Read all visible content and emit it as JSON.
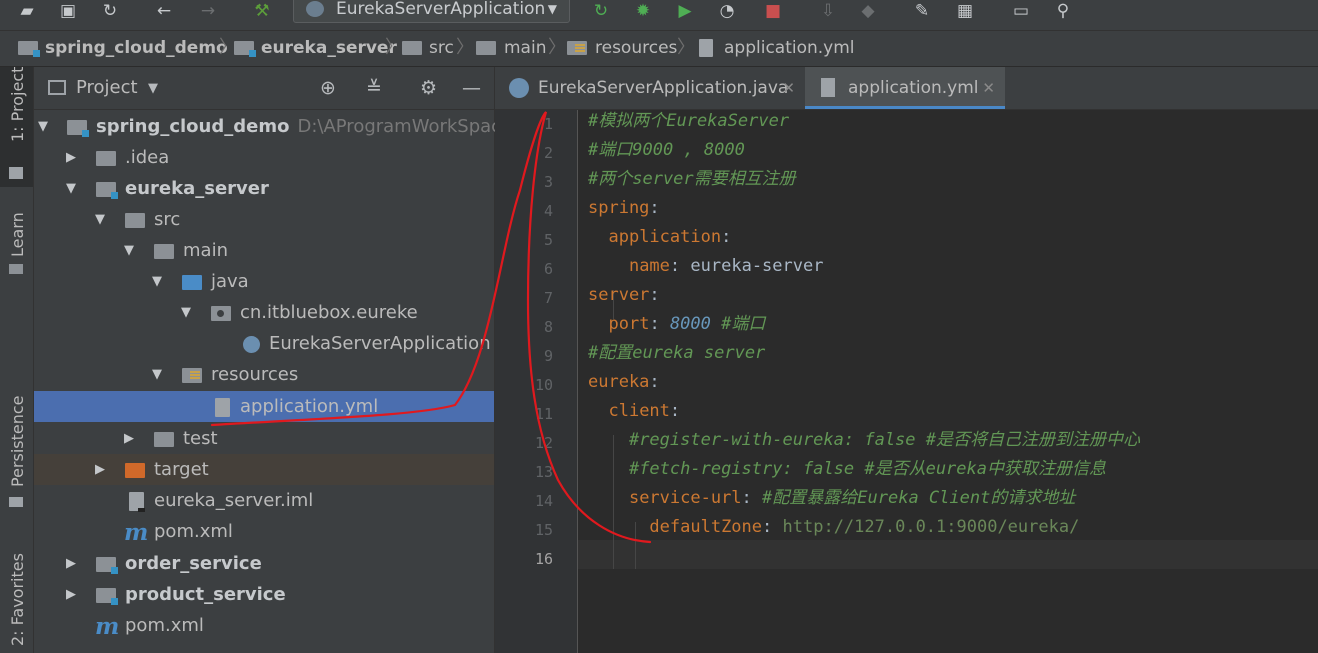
{
  "toolbar": {
    "run_config": "EurekaServerApplication",
    "icons": [
      "open-folder-icon",
      "save-icon",
      "sync-icon",
      "back-icon",
      "forward-icon",
      "build-hammer-icon",
      "run-icon",
      "debug-icon",
      "run-coverage-icon",
      "profile-icon",
      "stop-icon",
      "attach-icon",
      "sdk-icon",
      "settings-wrench-icon",
      "project-structure-icon",
      "terminal-icon",
      "search-icon"
    ]
  },
  "breadcrumb": [
    "spring_cloud_demo",
    "eureka_server",
    "src",
    "main",
    "resources",
    "application.yml"
  ],
  "side_tabs": {
    "project": "1: Project",
    "learn": "Learn",
    "persistence": "Persistence",
    "favorites": "2: Favorites"
  },
  "project_panel": {
    "title": "Project"
  },
  "tree": [
    {
      "label": "spring_cloud_demo",
      "path": "D:\\AProgramWorkSpace\\ide"
    },
    {
      "label": ".idea"
    },
    {
      "label": "eureka_server"
    },
    {
      "label": "src"
    },
    {
      "label": "main"
    },
    {
      "label": "java"
    },
    {
      "label": "cn.itbluebox.eureke"
    },
    {
      "label": "EurekaServerApplication"
    },
    {
      "label": "resources"
    },
    {
      "label": "application.yml"
    },
    {
      "label": "test"
    },
    {
      "label": "target"
    },
    {
      "label": "eureka_server.iml"
    },
    {
      "label": "pom.xml"
    },
    {
      "label": "order_service"
    },
    {
      "label": "product_service"
    },
    {
      "label": "pom.xml"
    }
  ],
  "tabs": [
    {
      "label": "EurekaServerApplication.java"
    },
    {
      "label": "application.yml"
    }
  ],
  "line_numbers": [
    "1",
    "2",
    "3",
    "4",
    "5",
    "6",
    "7",
    "8",
    "9",
    "10",
    "11",
    "12",
    "13",
    "14",
    "15",
    "16"
  ],
  "code": {
    "l1": "#模拟两个EurekaServer",
    "l2": "#端口9000 , 8000",
    "l3": "#两个server需要相互注册",
    "l4_key": "spring",
    "l5_key": "application",
    "l6_key": "name",
    "l6_val": "eureka-server",
    "l7_key": "server",
    "l8_key": "port",
    "l8_num": "8000",
    "l8_com": "#端口",
    "l9": "#配置eureka server",
    "l10_key": "eureka",
    "l11_key": "client",
    "l12": "#register-with-eureka: false #是否将自己注册到注册中心",
    "l13": "#fetch-registry: false #是否从eureka中获取注册信息",
    "l14_key": "service-url",
    "l14_com": "#配置暴露给Eureka Client的请求地址",
    "l15_key": "defaultZone",
    "l15_val": "http://127.0.0.1:9000/eureka/",
    "colon": ":"
  },
  "colors": {
    "annotation": "#e0191e",
    "selection": "#4b6eaf",
    "comment": "#629755",
    "key": "#cc7832",
    "number": "#6897bb"
  }
}
